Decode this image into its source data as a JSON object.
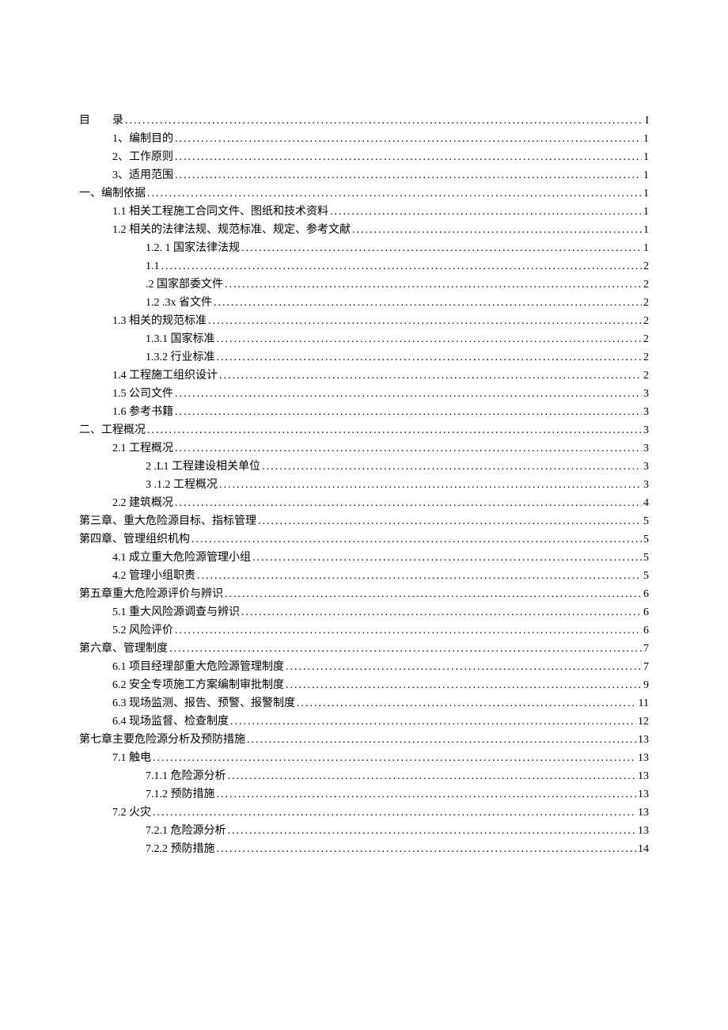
{
  "toc": [
    {
      "indent": 0,
      "label": "目　　录",
      "page": "I"
    },
    {
      "indent": 1,
      "label": "1、编制目的",
      "page": "1"
    },
    {
      "indent": 1,
      "label": "2、工作原则",
      "page": "1"
    },
    {
      "indent": 1,
      "label": "3、适用范围",
      "page": "1"
    },
    {
      "indent": 0,
      "label": "一、编制依据",
      "page": "1"
    },
    {
      "indent": 1,
      "label": "1.1 相关工程施工合同文件、图纸和技术资料",
      "page": "1"
    },
    {
      "indent": 1,
      "label": "1.2 相关的法律法规、规范标准、规定、参考文献",
      "page": "1"
    },
    {
      "indent": 2,
      "label": "1.2. 1 国家法律法规",
      "page": "1"
    },
    {
      "indent": 2,
      "label": "1.1",
      "page": "2"
    },
    {
      "indent": 2,
      "label": ".2 国家部委文件",
      "page": "2"
    },
    {
      "indent": 2,
      "label": "1.2 .3x 省文件",
      "page": "2"
    },
    {
      "indent": 1,
      "label": "1.3 相关的规范标准",
      "page": "2"
    },
    {
      "indent": 2,
      "label": "1.3.1 国家标准",
      "page": "2"
    },
    {
      "indent": 2,
      "label": "1.3.2 行业标准",
      "page": "2"
    },
    {
      "indent": 1,
      "label": "1.4 工程施工组织设计",
      "page": "2"
    },
    {
      "indent": 1,
      "label": "1.5 公司文件",
      "page": "3"
    },
    {
      "indent": 1,
      "label": "1.6 参考书籍",
      "page": "3"
    },
    {
      "indent": 0,
      "label": "二、工程概况",
      "page": "3"
    },
    {
      "indent": 1,
      "label": "2.1 工程概况",
      "page": "3"
    },
    {
      "indent": 2,
      "label": "2 .L1 工程建设相关单位",
      "page": "3"
    },
    {
      "indent": 2,
      "label": "3 .1.2 工程概况",
      "page": "3"
    },
    {
      "indent": 1,
      "label": "2.2 建筑概况",
      "page": "4"
    },
    {
      "indent": 0,
      "label": "第三章、重大危险源目标、指标管理",
      "page": "5"
    },
    {
      "indent": 0,
      "label": "第四章、管理组织机构",
      "page": "5"
    },
    {
      "indent": 1,
      "label": "4.1 成立重大危险源管理小组",
      "page": "5"
    },
    {
      "indent": 1,
      "label": "4.2 管理小组职责",
      "page": "5"
    },
    {
      "indent": 0,
      "label": "第五章重大危险源评价与辨识",
      "page": "6"
    },
    {
      "indent": 1,
      "label": "5.1 重大风险源调查与辨识",
      "page": "6"
    },
    {
      "indent": 1,
      "label": "5.2 风险评价",
      "page": "6"
    },
    {
      "indent": 0,
      "label": "第六章、管理制度",
      "page": "7"
    },
    {
      "indent": 1,
      "label": "6.1 项目经理部重大危险源管理制度",
      "page": "7"
    },
    {
      "indent": 1,
      "label": "6.2 安全专项施工方案编制审批制度",
      "page": "9"
    },
    {
      "indent": 1,
      "label": "6.3 现场监测、报告、预警、报警制度",
      "page": "11"
    },
    {
      "indent": 1,
      "label": "6.4 现场监督、检查制度",
      "page": "12"
    },
    {
      "indent": 0,
      "label": "第七章主要危险源分析及预防措施",
      "page": "13"
    },
    {
      "indent": 1,
      "label": "7.1 触电",
      "page": "13"
    },
    {
      "indent": 2,
      "label": "7.1.1 危险源分析",
      "page": "13"
    },
    {
      "indent": 2,
      "label": "7.1.2 预防措施",
      "page": "13"
    },
    {
      "indent": 1,
      "label": "7.2 火灾",
      "page": "13"
    },
    {
      "indent": 2,
      "label": "7.2.1 危险源分析",
      "page": "13"
    },
    {
      "indent": 2,
      "label": "7.2.2 预防措施",
      "page": "14"
    }
  ]
}
